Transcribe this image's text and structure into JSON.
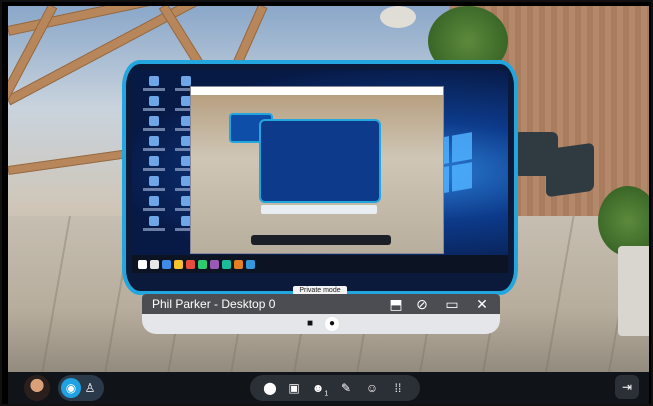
{
  "window": {
    "title": "Phil Parker - Desktop 0"
  },
  "controls": {
    "title": "Phil Parker - Desktop 0",
    "private_mode_tooltip": "Private mode",
    "icons": [
      "share-screen-icon",
      "hide-eye-icon",
      "monitor-toggle-icon",
      "close-icon",
      "camera-icon",
      "mic-icon"
    ]
  },
  "bottom_bar": {
    "icons": [
      "avatar",
      "mode-view-icon",
      "mode-person-icon",
      "location-icon",
      "window-icon",
      "users-icon",
      "mute-mic-icon",
      "emoji-icon",
      "apps-grid-icon",
      "exit-icon"
    ],
    "users_badge": "1"
  },
  "colors": {
    "accent": "#23a6de",
    "bar_bg": "#101418",
    "control_top": "#4b4d52"
  }
}
